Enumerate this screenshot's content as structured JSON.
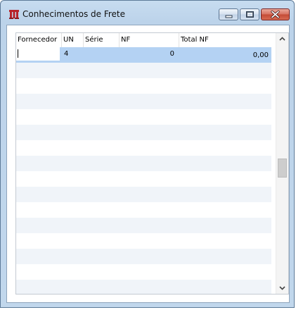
{
  "window": {
    "title": "Conhecimentos de Frete",
    "buttons": {
      "minimize": "minimize-icon",
      "maximize": "maximize-icon",
      "close": "close-icon"
    }
  },
  "grid": {
    "columns": [
      "Fornecedor",
      "UN",
      "Série",
      "NF",
      "Total NF"
    ],
    "rows": [
      {
        "fornecedor": "",
        "un": "4",
        "serie": "",
        "nf": "0",
        "total_nf": "0,00",
        "selected": true
      }
    ],
    "empty_row_count": 15
  },
  "colors": {
    "selected_row": "#b4d2f3",
    "alt_row": "#f0f4f9",
    "window_frame": "#c1d7ec",
    "close_button": "#c44a35"
  },
  "scrollbar": {
    "up_icon": "chevron-up-icon",
    "down_icon": "chevron-down-icon",
    "position": 0.45
  }
}
